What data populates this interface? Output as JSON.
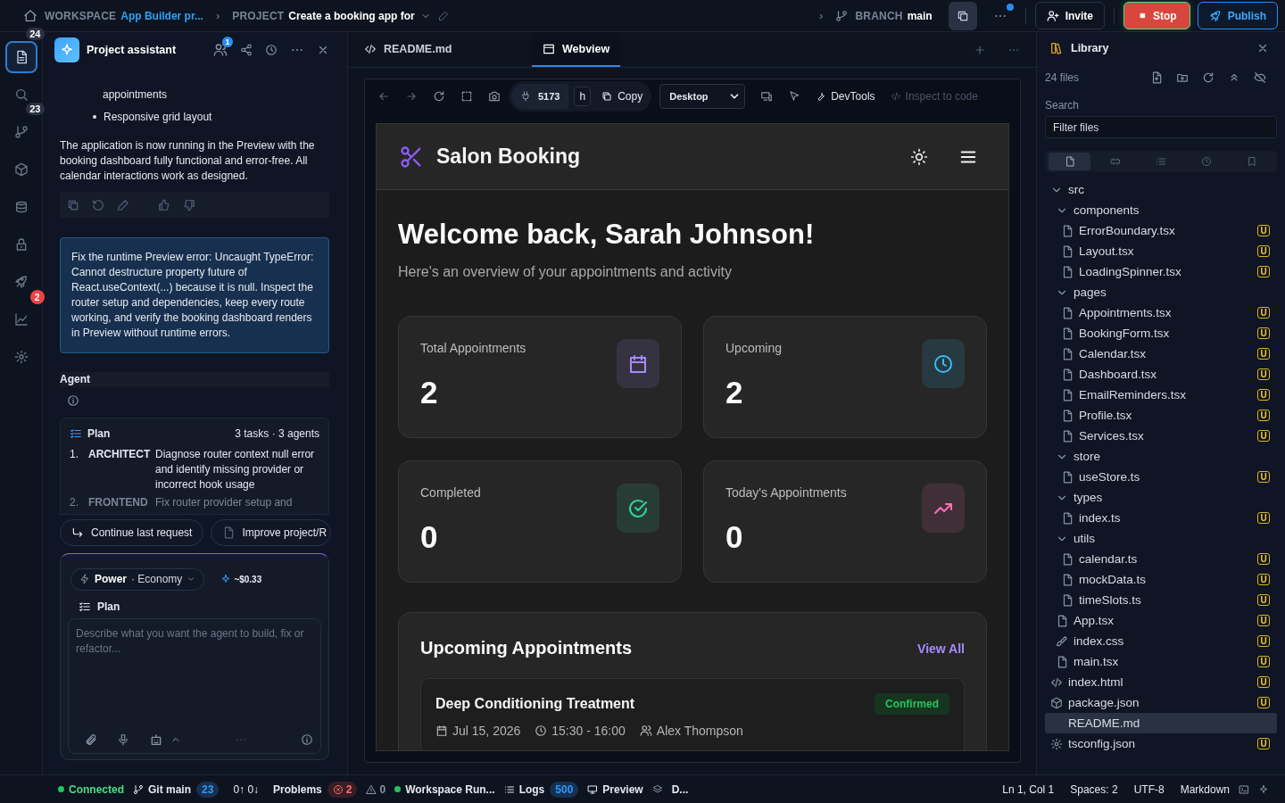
{
  "topbar": {
    "workspace_label": "WORKSPACE",
    "workspace": "App Builder pr...",
    "separator": "›",
    "project_label": "PROJECT",
    "project": "Create a booking app for",
    "branch_separator": "›",
    "branch_label": "BRANCH",
    "branch": "main",
    "notification_dot": true,
    "buttons": [
      {
        "label": "Invite",
        "kind": "outline"
      },
      {
        "label": "Stop",
        "kind": "danger"
      },
      {
        "label": "Publish",
        "kind": "primary"
      }
    ]
  },
  "activity_bar": [
    {
      "selected": true,
      "badge": "24",
      "alert": false
    },
    {
      "selected": false
    },
    {
      "selected": false,
      "badge": "23",
      "alert": false
    },
    {
      "selected": false
    },
    {
      "selected": false
    },
    {
      "selected": false
    },
    {
      "selected": false
    },
    {
      "selected": false,
      "badge": "2",
      "alert": true
    },
    {
      "selected": false
    }
  ],
  "assistant": {
    "title": "Project assistant",
    "collaborators_badge": "1",
    "messages": [
      {
        "kind": "continuation",
        "text": "appointments"
      },
      {
        "kind": "bullet",
        "text": "Responsive grid layout"
      },
      {
        "kind": "paragraph",
        "text": "The application is now running in the Preview with the booking dashboard fully functional and error-free. All calendar interactions work as designed."
      }
    ],
    "user_message": "Fix the runtime Preview error: Uncaught TypeError: Cannot destructure property future of React.useContext(...) because it is null. Inspect the router setup and dependencies, keep every route working, and verify the booking dashboard renders in Preview without runtime errors.",
    "agent_heading": "Agent",
    "plan": {
      "title": "Plan",
      "summary": "3 tasks · 3 agents",
      "tasks": [
        {
          "number": "1.",
          "role": "ARCHITECT",
          "text": "Diagnose router context null error and identify missing provider or incorrect hook usage",
          "faded": false
        },
        {
          "number": "2.",
          "role": "FRONTEND",
          "text": "Fix router provider setup and",
          "faded": true
        }
      ]
    },
    "suggestions": [
      {
        "label": "Continue last request",
        "kind": "continue"
      },
      {
        "label": "Improve project/R",
        "kind": "file"
      }
    ],
    "composer": {
      "mode": "Power",
      "separator": "·",
      "tier": "Economy",
      "cost": "~$0.33",
      "plan": "Plan",
      "placeholder": "Describe what you want the agent to build, fix or refactor..."
    }
  },
  "editor_tabs": [
    {
      "label": "README.md",
      "selected": false
    },
    {
      "label": "Webview",
      "selected": true
    }
  ],
  "browser_toolbar": {
    "port": "5173",
    "host": "h",
    "copy": "Copy",
    "device": "Desktop",
    "tools": [
      {
        "label": "DevTools",
        "disabled": false
      },
      {
        "label": "Inspect to code",
        "disabled": true
      }
    ]
  },
  "app": {
    "title": "Salon Booking",
    "welcome": "Welcome back, Sarah Johnson!",
    "subtitle": "Here's an overview of your appointments and activity",
    "stats": [
      {
        "label": "Total Appointments",
        "value": "2",
        "color": "#a78bfa"
      },
      {
        "label": "Upcoming",
        "value": "2",
        "color": "#38bdf8"
      },
      {
        "label": "Completed",
        "value": "0",
        "color": "#34d399"
      },
      {
        "label": "Today's Appointments",
        "value": "0",
        "color": "#f472b6"
      }
    ],
    "upcoming": {
      "title": "Upcoming Appointments",
      "link": "View All",
      "appointments": [
        {
          "service": "Deep Conditioning Treatment",
          "status": "Confirmed",
          "date": "Jul 15, 2026",
          "time": "15:30 - 16:00",
          "stylist": "Alex Thompson"
        }
      ]
    }
  },
  "library": {
    "title": "Library",
    "count": "24 files",
    "search_label": "Search",
    "filter_placeholder": "Filter files",
    "view_tabs": [
      {
        "selected": true
      },
      {
        "selected": false
      },
      {
        "selected": false
      },
      {
        "selected": false
      },
      {
        "selected": false
      }
    ],
    "tree": [
      {
        "name": "src",
        "kind": "folder",
        "expanded": true,
        "selected": false,
        "children": [
          {
            "name": "components",
            "kind": "folder",
            "expanded": true,
            "selected": false,
            "children": [
              {
                "name": "ErrorBoundary.tsx",
                "kind": "script",
                "badge": "U",
                "selected": false
              },
              {
                "name": "Layout.tsx",
                "kind": "script",
                "badge": "U",
                "selected": false
              },
              {
                "name": "LoadingSpinner.tsx",
                "kind": "script",
                "badge": "U",
                "selected": false
              }
            ]
          },
          {
            "name": "pages",
            "kind": "folder",
            "expanded": true,
            "selected": false,
            "children": [
              {
                "name": "Appointments.tsx",
                "kind": "script",
                "badge": "U",
                "selected": false
              },
              {
                "name": "BookingForm.tsx",
                "kind": "script",
                "badge": "U",
                "selected": false
              },
              {
                "name": "Calendar.tsx",
                "kind": "script",
                "badge": "U",
                "selected": false
              },
              {
                "name": "Dashboard.tsx",
                "kind": "script",
                "badge": "U",
                "selected": false
              },
              {
                "name": "EmailReminders.tsx",
                "kind": "script",
                "badge": "U",
                "selected": false
              },
              {
                "name": "Profile.tsx",
                "kind": "script",
                "badge": "U",
                "selected": false
              },
              {
                "name": "Services.tsx",
                "kind": "script",
                "badge": "U",
                "selected": false
              }
            ]
          },
          {
            "name": "store",
            "kind": "folder",
            "expanded": true,
            "selected": false,
            "children": [
              {
                "name": "useStore.ts",
                "kind": "script",
                "badge": "U",
                "selected": false
              }
            ]
          },
          {
            "name": "types",
            "kind": "folder",
            "expanded": true,
            "selected": false,
            "children": [
              {
                "name": "index.ts",
                "kind": "script",
                "badge": "U",
                "selected": false
              }
            ]
          },
          {
            "name": "utils",
            "kind": "folder",
            "expanded": true,
            "selected": false,
            "children": [
              {
                "name": "calendar.ts",
                "kind": "script",
                "badge": "U",
                "selected": false
              },
              {
                "name": "mockData.ts",
                "kind": "script",
                "badge": "U",
                "selected": false
              },
              {
                "name": "timeSlots.ts",
                "kind": "script",
                "badge": "U",
                "selected": false
              }
            ]
          },
          {
            "name": "App.tsx",
            "kind": "script",
            "badge": "U",
            "selected": false
          },
          {
            "name": "index.css",
            "kind": "style",
            "badge": "U",
            "selected": false
          },
          {
            "name": "main.tsx",
            "kind": "script",
            "badge": "U",
            "selected": false
          }
        ]
      },
      {
        "name": "index.html",
        "kind": "markup",
        "badge": "U",
        "selected": false
      },
      {
        "name": "package.json",
        "kind": "package",
        "badge": "U",
        "selected": false
      },
      {
        "name": "README.md",
        "kind": "doc",
        "selected": true
      },
      {
        "name": "tsconfig.json",
        "kind": "config",
        "badge": "U",
        "selected": false
      }
    ]
  },
  "status_bar": {
    "connection": "Connected",
    "git": "Git main",
    "changes": "23",
    "sync": "0↑ 0↓",
    "problems_label": "Problems",
    "errors": "2",
    "warnings": "0",
    "workspace": "Workspace Run...",
    "logs_label": "Logs",
    "logs": "500",
    "preview_label": "Preview",
    "preview": "D...",
    "right": [
      "Ln 1, Col 1",
      "Spaces: 2",
      "UTF-8",
      "Markdown"
    ]
  }
}
